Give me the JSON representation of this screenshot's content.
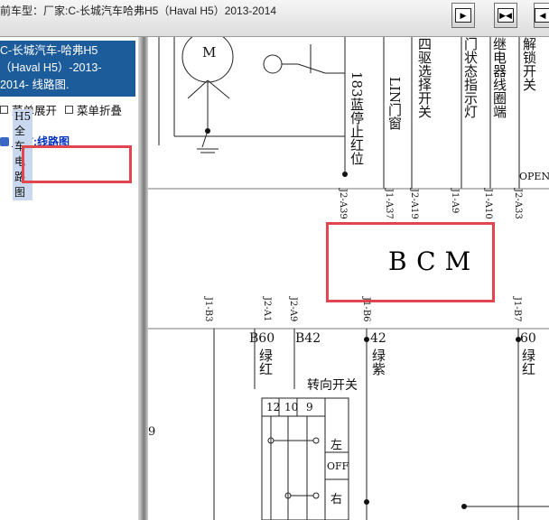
{
  "toolbar": {
    "title": "前车型：厂家:C-长城汽车哈弗H5（Haval H5）2013-2014",
    "buttons": [
      {
        "name": "next-page-button",
        "glyph": "▶"
      },
      {
        "name": "fit-width-button",
        "glyph": "▶◀"
      },
      {
        "name": "expand-width-button",
        "glyph": "◀▶"
      }
    ]
  },
  "sidebar": {
    "car_lines": [
      "C-长城汽车-哈弗H5",
      "（Haval H5）-2013-",
      "2014- 线路图."
    ],
    "expand_label": "菜单展开",
    "collapse_label": "菜单折叠",
    "tree_root": "当前:线路图",
    "tree_item": "H5全车电路图"
  },
  "diagram": {
    "top_labels": [
      {
        "name": "label-183-brake-light",
        "text": "183蓝停止红位"
      },
      {
        "name": "label-lin-door",
        "text": "LIN门窗"
      },
      {
        "name": "label-4wd-select",
        "text": "四驱选择开关"
      },
      {
        "name": "label-door-indicator",
        "text": "门状态指示灯"
      },
      {
        "name": "label-relay-coil",
        "text": "继电器线圈端"
      },
      {
        "name": "label-unlock-switch",
        "text": "解锁开关"
      }
    ],
    "open_text": "OPEN",
    "motor_symbol": "M",
    "bcm_pins_top": [
      "J2-A39",
      "J1-A37",
      "J2-A19",
      "J1-A9",
      "J1-A10",
      "J2-A33"
    ],
    "bcm_label": "BCM",
    "bcm_pins_bottom": [
      "J1-B3",
      "J2-A1",
      "J2-A9",
      "J1-B6",
      "J1-B7"
    ],
    "wires": [
      {
        "name": "wire-b60",
        "number": "B60",
        "color": "绿红"
      },
      {
        "name": "wire-b42",
        "number": "B42",
        "color": ""
      },
      {
        "name": "wire-42",
        "number": "42",
        "color": "绿紫"
      },
      {
        "name": "wire-60",
        "number": "60",
        "color": "绿红"
      }
    ],
    "switch_title": "转向开关",
    "switch_pins": [
      "12",
      "10",
      "9"
    ],
    "switch_positions": [
      "左",
      "OFF",
      "右"
    ],
    "edge_fragment": "9"
  }
}
